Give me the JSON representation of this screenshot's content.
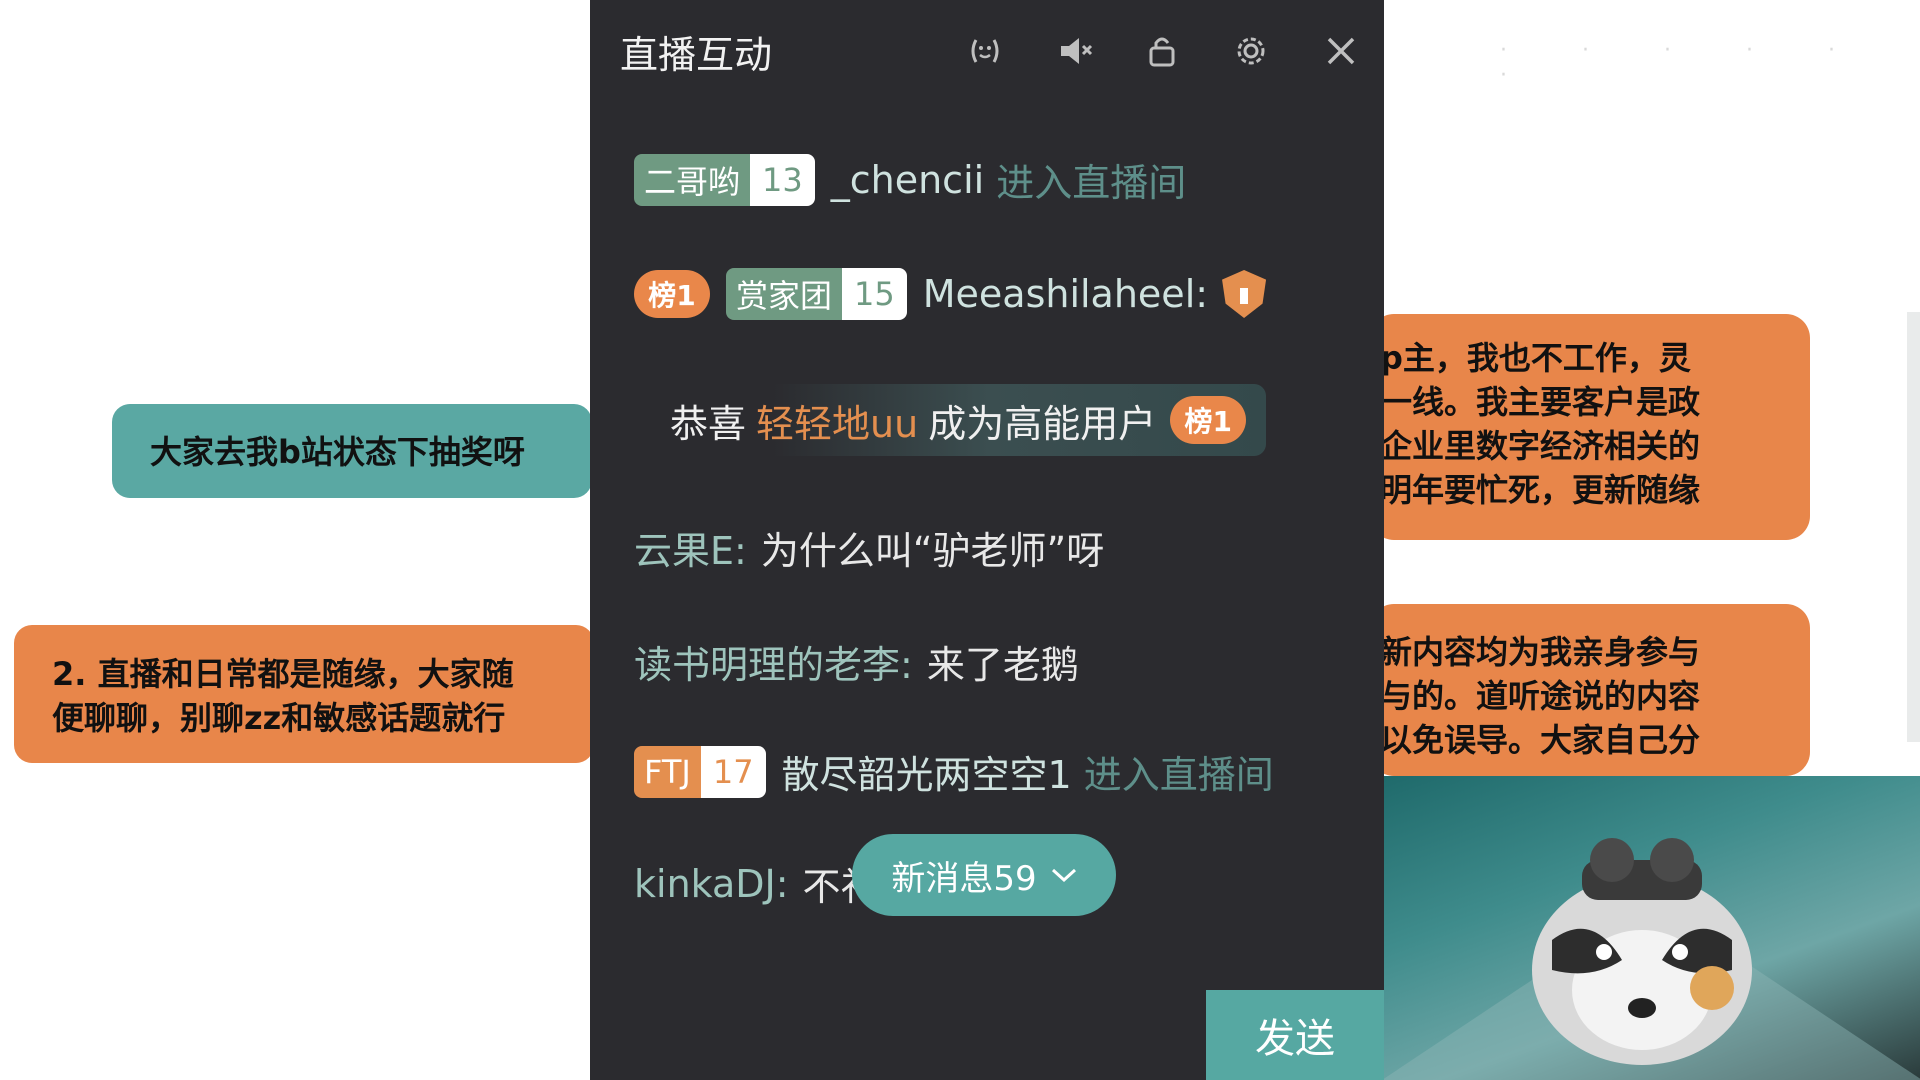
{
  "slide": {
    "teal_note": "大家去我b站状态下抽奖呀",
    "left_orange_note": [
      "2. 直播和日常都是随缘，大家随",
      "便聊聊，别聊zz和敏感话题就行"
    ],
    "right_orange_note_1": [
      "p主，我也不工作，灵",
      "一线。我主要客户是政",
      "企业里数字经济相关的",
      "明年要忙死，更新随缘"
    ],
    "right_orange_note_2": [
      "新内容均为我亲身参与",
      "与的。道听途说的内容",
      "以免误导。大家自己分"
    ]
  },
  "panel": {
    "title": "直播互动",
    "header_icons": [
      "face-icon",
      "speaker-icon",
      "lock-icon",
      "gear-icon",
      "close-icon"
    ],
    "messages": [
      {
        "medal_name": "二哥哟",
        "medal_level": "13",
        "user": "_chencii",
        "action": "进入直播间"
      },
      {
        "rank": "榜1",
        "medal_name": "赏家团",
        "medal_level": "15",
        "user": "Meeashilaheel:"
      },
      {
        "prefix": "恭喜",
        "user": "轻轻地uu",
        "suffix": "成为高能用户",
        "rank": "榜1"
      },
      {
        "user": "云果E:",
        "text": "为什么叫“驴老师”呀"
      },
      {
        "user": "读书明理的老李:",
        "text": "来了老鹅"
      },
      {
        "medal_name": "FTJ",
        "medal_level": "17",
        "user": "散尽韶光两空空1",
        "action": "进入直播间"
      },
      {
        "user": "kinkaDJ:",
        "text": "不礼"
      }
    ],
    "new_messages": "新消息59",
    "send_label": "发送"
  },
  "colors": {
    "panel_bg": "#2b2b2f",
    "accent_teal": "#56a8a2",
    "accent_orange": "#e48f4f"
  }
}
